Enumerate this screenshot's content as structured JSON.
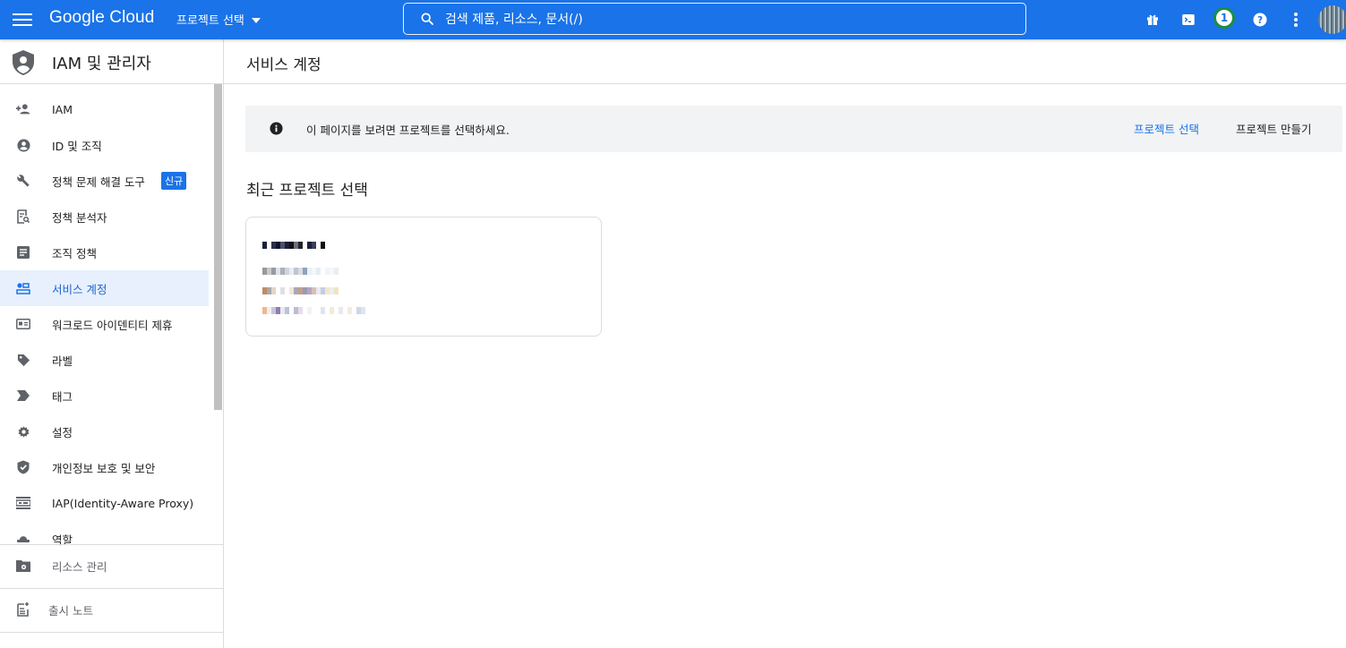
{
  "header": {
    "logo": "Google Cloud",
    "project_picker": "프로젝트 선택",
    "search_text": "검색   제품, 리소스, 문서(/)",
    "notification_count": "1",
    "brand_color": "#1a73e8"
  },
  "sidebar": {
    "title": "IAM 및 관리자",
    "items": [
      {
        "label": "IAM",
        "icon": "person-add-icon"
      },
      {
        "label": "ID 및 조직",
        "icon": "account-circle-icon"
      },
      {
        "label": "정책 문제 해결 도구",
        "icon": "wrench-icon",
        "badge": "신규"
      },
      {
        "label": "정책 분석자",
        "icon": "doc-search-icon"
      },
      {
        "label": "조직 정책",
        "icon": "list-doc-icon"
      },
      {
        "label": "서비스 계정",
        "icon": "service-account-icon",
        "active": true
      },
      {
        "label": "워크로드 아이덴티티 제휴",
        "icon": "id-card-icon"
      },
      {
        "label": "라벨",
        "icon": "label-icon"
      },
      {
        "label": "태그",
        "icon": "tag-icon"
      },
      {
        "label": "설정",
        "icon": "gear-icon"
      },
      {
        "label": "개인정보 보호 및 보안",
        "icon": "shield-check-icon"
      },
      {
        "label": "IAP(Identity-Aware Proxy)",
        "icon": "iap-icon"
      },
      {
        "label": "역할",
        "icon": "hat-icon"
      }
    ],
    "bottom": [
      {
        "label": "리소스 관리",
        "icon": "folder-gear-icon"
      },
      {
        "label": "출시 노트",
        "icon": "release-notes-icon"
      }
    ]
  },
  "main": {
    "title": "서비스 계정",
    "banner": {
      "text": "이 페이지를 보려면 프로젝트를 선택하세요.",
      "select_link": "프로젝트 선택",
      "create_button": "프로젝트 만들기"
    },
    "recent_title": "최근 프로젝트 선택"
  }
}
